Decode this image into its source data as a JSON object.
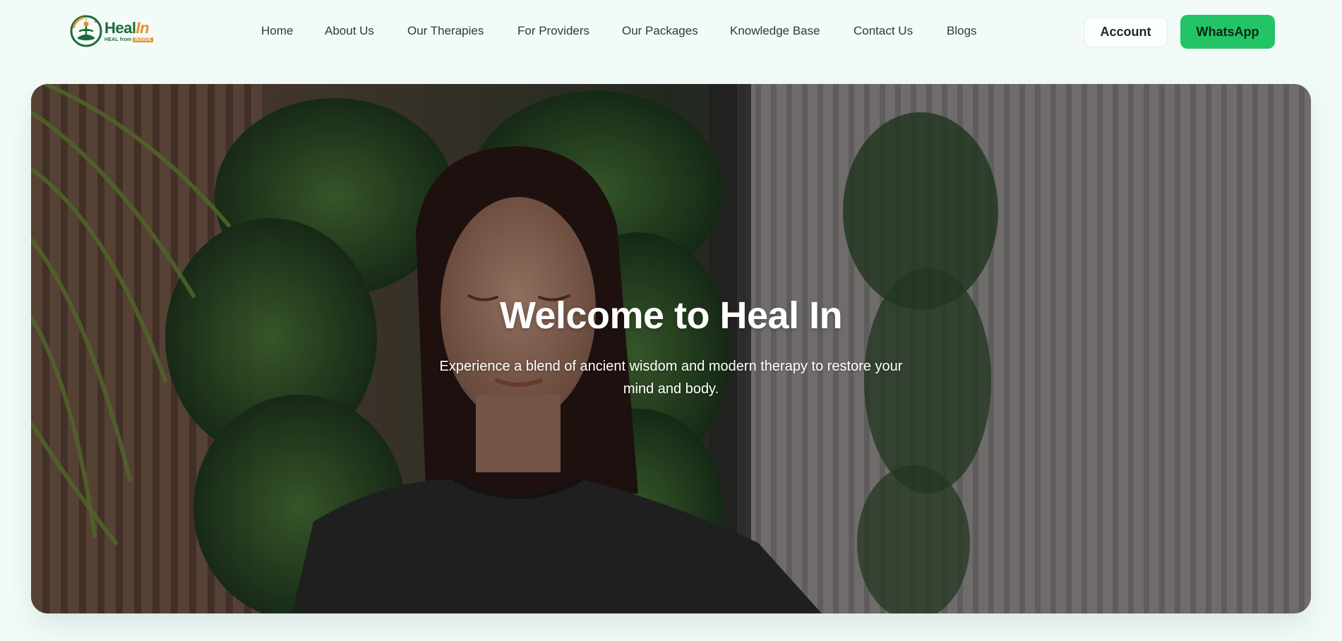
{
  "brand": {
    "name_part1": "Heal",
    "name_part2": "In",
    "tagline_prefix": "HEAL from",
    "tagline_highlight": "INSIDE",
    "colors": {
      "green": "#1f6b3a",
      "orange": "#e8902a"
    }
  },
  "nav": {
    "items": [
      {
        "label": "Home"
      },
      {
        "label": "About Us"
      },
      {
        "label": "Our Therapies"
      },
      {
        "label": "For Providers"
      },
      {
        "label": "Our Packages"
      },
      {
        "label": "Knowledge Base"
      },
      {
        "label": "Contact Us"
      },
      {
        "label": "Blogs"
      }
    ]
  },
  "actions": {
    "account_label": "Account",
    "whatsapp_label": "WhatsApp",
    "whatsapp_color": "#23c465"
  },
  "hero": {
    "title": "Welcome to Heal In",
    "subtitle": "Experience a blend of ancient wisdom and modern therapy to restore your mind and body."
  },
  "page": {
    "background": "#f3fbf8"
  }
}
